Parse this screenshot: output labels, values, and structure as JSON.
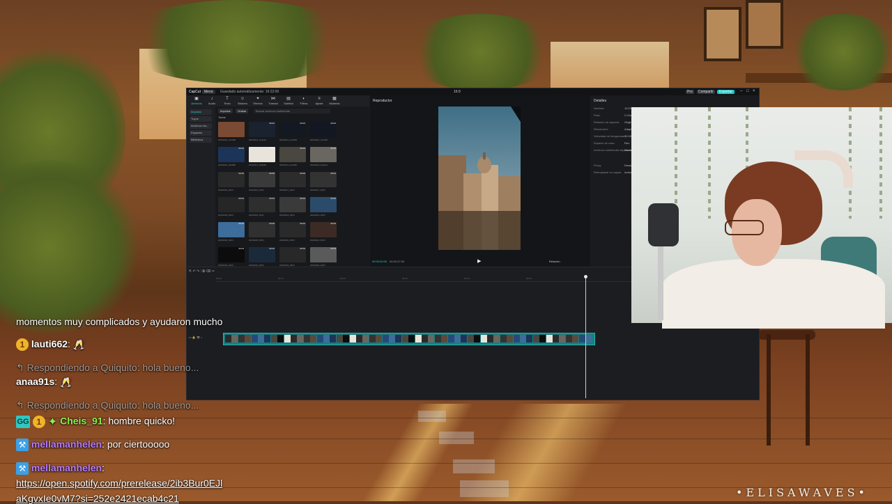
{
  "editor": {
    "app_name": "CapCut",
    "menu": "Menú",
    "doc_name": "Guardado automáticamente: 19:22:00",
    "aspect_ratio": "16:9",
    "pro_label": "Pro",
    "share_label": "Compartir",
    "export_label": "Exportar",
    "toolbar": [
      {
        "icon": "media-icon",
        "glyph": "▣",
        "label": "Archivos multimedia"
      },
      {
        "icon": "audio-icon",
        "glyph": "♪",
        "label": "Audio"
      },
      {
        "icon": "text-icon",
        "glyph": "T",
        "label": "Texto"
      },
      {
        "icon": "sticker-icon",
        "glyph": "☺",
        "label": "Stickers"
      },
      {
        "icon": "effects-icon",
        "glyph": "✦",
        "label": "Efectos"
      },
      {
        "icon": "transitions-icon",
        "glyph": "⋈",
        "label": "Transiciones"
      },
      {
        "icon": "subtitles-icon",
        "glyph": "▤",
        "label": "Subtítulos"
      },
      {
        "icon": "filters-icon",
        "glyph": "◐",
        "label": "Filtros"
      },
      {
        "icon": "adjust-icon",
        "glyph": "≡",
        "label": "Ajuste"
      },
      {
        "icon": "templates-icon",
        "glyph": "▦",
        "label": "Modelos de IA"
      }
    ],
    "sidebar": [
      {
        "label": "Importar",
        "active": true
      },
      {
        "label": "Tuyos",
        "active": false
      },
      {
        "label": "Archivos mu...",
        "active": false
      },
      {
        "label": "Espacios",
        "active": false
      },
      {
        "label": "Biblioteca",
        "active": false
      }
    ],
    "media": {
      "import_label": "Importar",
      "record_label": "Grabar",
      "search_placeholder": "Buscar archivos multimedia",
      "section_label": "Todos",
      "thumbs": [
        {
          "dur": "",
          "name": "20231012_141235",
          "color": "#7a4a32"
        },
        {
          "dur": "00:03",
          "name": "20231012_141241",
          "color": "#1a2230"
        },
        {
          "dur": "00:03",
          "name": "20231012_141305",
          "color": "#141820"
        },
        {
          "dur": "00:02",
          "name": "20231012_141322",
          "color": "#121722"
        },
        {
          "dur": "00:03",
          "name": "20231013_091806",
          "color": "#1c3458"
        },
        {
          "dur": "00:05",
          "name": "20231013_092054",
          "color": "#e8e4dc"
        },
        {
          "dur": "00:04",
          "name": "20231013_101452",
          "color": "#4a4640"
        },
        {
          "dur": "00:02",
          "name": "20231013_102113",
          "color": "#6a6660"
        },
        {
          "dur": "00:05",
          "name": "20231016_MOV",
          "color": "#2a2a2a"
        },
        {
          "dur": "00:06",
          "name": "20231016_MOV",
          "color": "#3a3a3a"
        },
        {
          "dur": "00:06",
          "name": "20231017_MOV",
          "color": "#2c2c2c"
        },
        {
          "dur": "00:04",
          "name": "20231017_MOV",
          "color": "#333333"
        },
        {
          "dur": "00:04",
          "name": "20231018_MOV",
          "color": "#262626"
        },
        {
          "dur": "00:03",
          "name": "20231018_MOV",
          "color": "#2e2e2e"
        },
        {
          "dur": "00:03",
          "name": "20231019_MOV",
          "color": "#3a3a3a"
        },
        {
          "dur": "00:02",
          "name": "20231019_MOV",
          "color": "#2a4c6a"
        },
        {
          "dur": "00:03",
          "name": "20231020_MOV",
          "color": "#3d6d9a"
        },
        {
          "dur": "00:03",
          "name": "20231020_MOV",
          "color": "#303030"
        },
        {
          "dur": "00:04",
          "name": "20231021_MOV",
          "color": "#2a2a2a"
        },
        {
          "dur": "00:03",
          "name": "20231021_MOV",
          "color": "#3c2a24"
        },
        {
          "dur": "00:03",
          "name": "20231022_MOV",
          "color": "#0c0c0c"
        },
        {
          "dur": "00:02",
          "name": "20231022_MOV",
          "color": "#1b2a3a"
        },
        {
          "dur": "00:03",
          "name": "20231023_MOV",
          "color": "#282828"
        },
        {
          "dur": "00:03",
          "name": "20231023_MOV",
          "color": "#5a5a5a"
        }
      ]
    },
    "player": {
      "title": "Reproductor",
      "current_time": "00:00:00:00",
      "total_time": "00:00:37:05",
      "ratio_label": "Relación"
    },
    "details": {
      "title": "Detalles",
      "rows": [
        {
          "k": "Nombre:",
          "v": "19:22"
        },
        {
          "k": "Ruta:",
          "v": "C:/Users/..."
        },
        {
          "k": "Relación de aspecto:",
          "v": "Original"
        },
        {
          "k": "Resolución:",
          "v": "Adaptada"
        },
        {
          "k": "Velocidad de fotogramas:",
          "v": "30.00fps"
        },
        {
          "k": "Espacio de color:",
          "v": "Rec. 709"
        },
        {
          "k": "Archivos multimedia importados:",
          "v": "Mantener"
        },
        {
          "k": "Proxy:",
          "v": "Desactivado"
        },
        {
          "k": "Reemplazar en capas:",
          "v": "Activado"
        }
      ]
    },
    "timeline": {
      "ticks": [
        "00:00",
        "00:10",
        "00:20",
        "00:30",
        "00:40",
        "00:50"
      ]
    }
  },
  "chat": [
    {
      "type": "text",
      "text": "momentos muy complicados y ayudaron mucho"
    },
    {
      "type": "msg",
      "badges": [
        "1"
      ],
      "user": "lauti662",
      "user_color": "#ffffff",
      "text": ""
    },
    {
      "type": "reply",
      "text": "Respondiendo a Quiquito: hola bueno..."
    },
    {
      "type": "msg",
      "badges": [],
      "user": "anaa91s",
      "user_color": "#ffffff",
      "text": ""
    },
    {
      "type": "reply",
      "text": "Respondiendo a Quiquito: hola bueno..."
    },
    {
      "type": "msg",
      "badges": [
        "GG",
        "1",
        "star"
      ],
      "user": "Cheis_91",
      "user_color": "#8ef04a",
      "text": "hombre quicko!"
    },
    {
      "type": "msg",
      "badges": [
        "pin"
      ],
      "user": "mellamanhelen",
      "user_color": "#b57bff",
      "text": "por ciertooooo"
    },
    {
      "type": "msg",
      "badges": [
        "pin"
      ],
      "user": "mellamanhelen",
      "user_color": "#b57bff",
      "text": ""
    },
    {
      "type": "link",
      "text": "https://open.spotify.com/prerelease/2ib3Bur0EJl"
    },
    {
      "type": "link",
      "text": "aKgvxIe0vM7?si=252e2421ecab4c21"
    }
  ],
  "brand": "•ELISAWAVES•",
  "colors": {
    "accent": "#2fd0cf",
    "track": "#1a7f80",
    "chat_reply": "#ffffff8c"
  }
}
